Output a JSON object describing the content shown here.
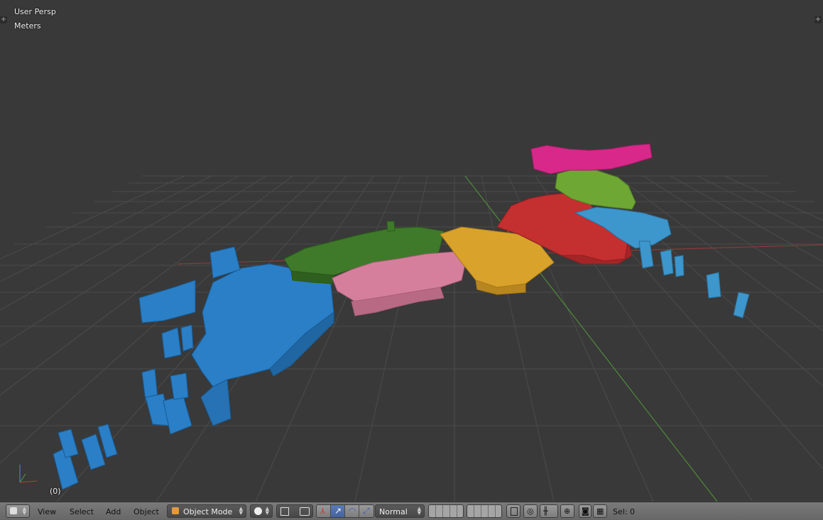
{
  "viewport": {
    "view_name": "User Persp",
    "units": "Meters",
    "frame": "(0)"
  },
  "header": {
    "menus": [
      "View",
      "Select",
      "Add",
      "Object"
    ],
    "mode": "Object Mode",
    "pivot_style": "Normal",
    "selection": "Sel: 0"
  },
  "icons": [
    "editor-type-icon",
    "viewport-shading-icon",
    "pivot-point-icon",
    "manipulator-icon",
    "translate-icon",
    "rotate-icon",
    "scale-icon",
    "layers-icon",
    "lock-camera-icon",
    "snap-icon",
    "snap-element-icon",
    "proportional-edit-icon",
    "render-icon",
    "opengl-render-icon"
  ],
  "colors": {
    "viewport_bg": "#393939",
    "grid": "#4a4a4a",
    "axis_x": "#8a3a3a",
    "axis_y": "#4f8a3a",
    "region_blue": "#2a7fc7",
    "region_green": "#3f7a2a",
    "region_pink": "#d67f9c",
    "region_orange": "#d9a22a",
    "region_red": "#c42f30",
    "region_lightblue": "#3d96cc",
    "region_lime": "#6fa734",
    "region_magenta": "#d8288a"
  }
}
